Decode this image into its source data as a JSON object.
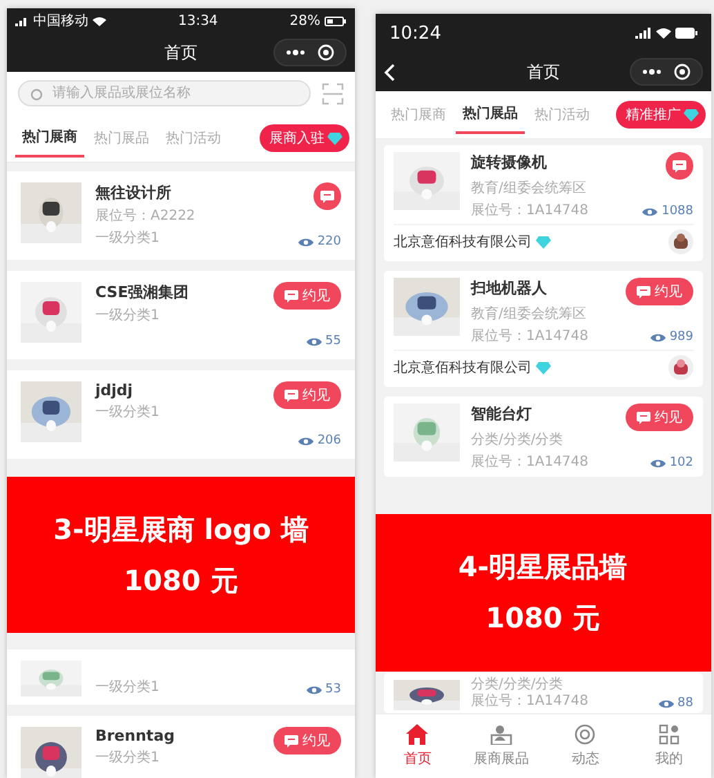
{
  "left_phone": {
    "status_bar": {
      "carrier": "中国移动",
      "time": "13:34",
      "battery": "28%"
    },
    "title": "首页",
    "search": {
      "placeholder": "请输入展品或展位名称"
    },
    "tabs": [
      {
        "label": "热门展商",
        "selected": true
      },
      {
        "label": "热门展品",
        "selected": false
      },
      {
        "label": "热门活动",
        "selected": false
      }
    ],
    "promo_button": "展商入驻",
    "exhibitors": [
      {
        "name": "無往设计所",
        "booth": "展位号：A2222",
        "category": "一级分类1",
        "views": "220",
        "button": {
          "kind": "icon"
        }
      },
      {
        "name": "CSE强湘集团",
        "category": "一级分类1",
        "views": "55",
        "button": {
          "kind": "labeled",
          "label": "约见"
        }
      },
      {
        "name": "jdjdj",
        "category": "一级分类1",
        "views": "206",
        "button": {
          "kind": "labeled",
          "label": "约见"
        }
      },
      {
        "category": "一级分类1",
        "views": "53"
      },
      {
        "name": "Brenntag",
        "category": "一级分类1",
        "button": {
          "kind": "labeled",
          "label": "约见"
        }
      }
    ],
    "banner": {
      "lines": [
        "3-明星展商 logo 墙",
        "1080 元"
      ]
    }
  },
  "right_phone": {
    "status_bar": {
      "time": "10:24"
    },
    "title": "首页",
    "tabs": [
      {
        "label": "热门展商",
        "selected": false
      },
      {
        "label": "热门展品",
        "selected": true
      },
      {
        "label": "热门活动",
        "selected": false
      }
    ],
    "promo_button": "精准推广",
    "products": [
      {
        "name": "旋转摄像机",
        "category": "教育/组委会统筹区",
        "booth": "展位号：1A14748",
        "views": "1088",
        "button": {
          "kind": "icon"
        },
        "company": "北京意佰科技有限公司"
      },
      {
        "name": "扫地机器人",
        "category": "教育/组委会统筹区",
        "booth": "展位号：1A14748",
        "views": "989",
        "button": {
          "kind": "labeled",
          "label": "约见"
        },
        "company": "北京意佰科技有限公司"
      },
      {
        "name": "智能台灯",
        "category": "分类/分类/分类",
        "booth": "展位号：1A14748",
        "views": "102",
        "button": {
          "kind": "labeled",
          "label": "约见"
        }
      },
      {
        "category": "分类/分类/分类",
        "booth": "展位号：1A14748",
        "views": "88"
      }
    ],
    "nav": [
      {
        "label": "首页",
        "selected": true
      },
      {
        "label": "展商展品",
        "selected": false
      },
      {
        "label": "动态",
        "selected": false
      },
      {
        "label": "我的",
        "selected": false
      }
    ],
    "banner": {
      "lines": [
        "4-明星展品墙",
        "1080 元"
      ]
    }
  }
}
